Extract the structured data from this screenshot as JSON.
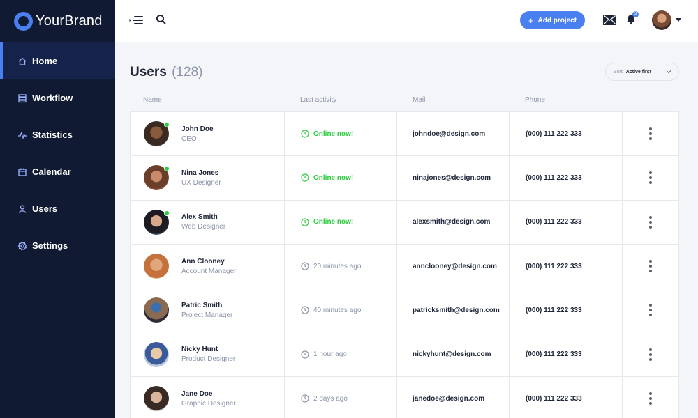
{
  "brand": {
    "name": "YourBrand"
  },
  "sidebar": {
    "items": [
      {
        "label": "Home",
        "icon": "home-icon",
        "active": true
      },
      {
        "label": "Workflow",
        "icon": "workflow-icon",
        "active": false
      },
      {
        "label": "Statistics",
        "icon": "statistics-icon",
        "active": false
      },
      {
        "label": "Calendar",
        "icon": "calendar-icon",
        "active": false
      },
      {
        "label": "Users",
        "icon": "user-icon",
        "active": false
      },
      {
        "label": "Settings",
        "icon": "gear-icon",
        "active": false
      }
    ]
  },
  "topbar": {
    "add_project_label": "Add project",
    "notification_count": "3"
  },
  "page": {
    "title": "Users",
    "count": "(128)",
    "sort_label": "Sort:",
    "sort_value": "Active first"
  },
  "table": {
    "headers": {
      "name": "Name",
      "last_activity": "Last activity",
      "mail": "Mail",
      "phone": "Phone"
    },
    "rows": [
      {
        "name": "John Doe",
        "role": "CEO",
        "activity": "Online now!",
        "online": true,
        "mail": "johndoe@design.com",
        "phone": "(000) 111 222 333"
      },
      {
        "name": "Nina Jones",
        "role": "UX Designer",
        "activity": "Online now!",
        "online": true,
        "mail": "ninajones@design.com",
        "phone": "(000) 111 222 333"
      },
      {
        "name": "Alex Smith",
        "role": "Web Designer",
        "activity": "Online now!",
        "online": true,
        "mail": "alexsmith@design.com",
        "phone": "(000) 111 222 333"
      },
      {
        "name": "Ann Clooney",
        "role": "Account Manager",
        "activity": "20 minutes ago",
        "online": false,
        "mail": "annclooney@design.com",
        "phone": "(000) 111 222 333"
      },
      {
        "name": "Patric Smith",
        "role": "Project Manager",
        "activity": "40 minutes ago",
        "online": false,
        "mail": "patricksmith@design.com",
        "phone": "(000) 111 222 333"
      },
      {
        "name": "Nicky Hunt",
        "role": "Product Designer",
        "activity": "1 hour ago",
        "online": false,
        "mail": "nickyhunt@design.com",
        "phone": "(000) 111 222 333"
      },
      {
        "name": "Jane Doe",
        "role": "Graphic Designer",
        "activity": "2 days ago",
        "online": false,
        "mail": "janedoe@design.com",
        "phone": "(000) 111 222 333"
      }
    ]
  },
  "colors": {
    "sidebar_bg": "#111a33",
    "accent": "#4a7ff0",
    "online": "#2ecc40",
    "muted": "#8a93a8"
  }
}
